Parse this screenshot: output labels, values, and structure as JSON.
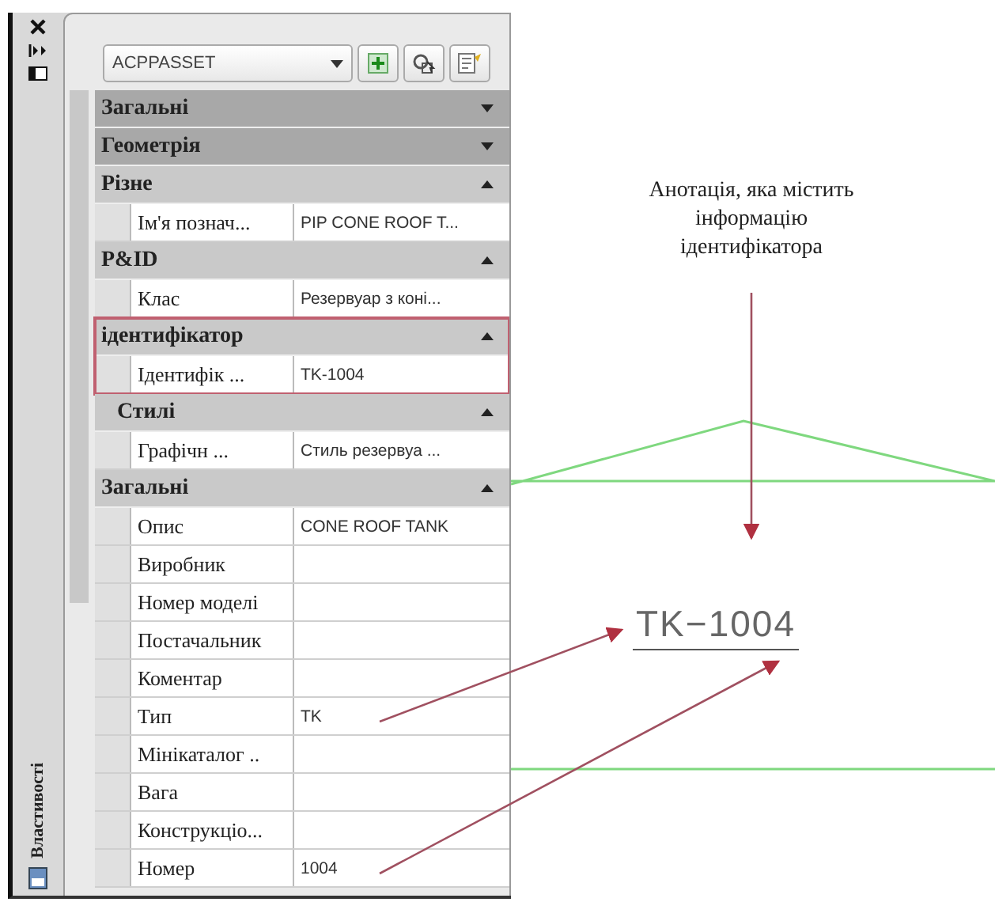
{
  "palette": {
    "title": "Властивості",
    "object_type": "ACPPASSET",
    "groups": [
      {
        "title": "Загальні",
        "kind": "category",
        "expanded": false,
        "highlighted": false
      },
      {
        "title": "Геометрія",
        "kind": "category",
        "expanded": false,
        "highlighted": false
      },
      {
        "title": "Різне",
        "kind": "category",
        "expanded": true,
        "highlighted": false,
        "properties": [
          {
            "name": "Ім'я познач...",
            "value": "PIP CONE ROOF T..."
          }
        ]
      },
      {
        "title": "P&ID",
        "kind": "category",
        "expanded": true,
        "highlighted": false,
        "properties": [
          {
            "name": "Клас",
            "value": "Резервуар з коні..."
          }
        ]
      },
      {
        "title": "ідентифікатор",
        "kind": "category",
        "expanded": true,
        "highlighted": true,
        "properties": [
          {
            "name": "Ідентифік ...",
            "value": "TK-1004"
          }
        ]
      },
      {
        "title": "Стилі",
        "kind": "subcategory",
        "expanded": true,
        "highlighted": false,
        "properties": [
          {
            "name": "Графічн ...",
            "value": "Стиль резервуа ..."
          }
        ]
      },
      {
        "title": "Загальні",
        "kind": "category",
        "expanded": true,
        "highlighted": false,
        "properties": [
          {
            "name": "Опис",
            "value": "CONE ROOF TANK"
          },
          {
            "name": "Виробник"
          },
          {
            "name": "Номер моделі"
          },
          {
            "name": "Постачальник"
          },
          {
            "name": "Коментар"
          },
          {
            "name": "Тип",
            "value": "TK"
          },
          {
            "name": "Мінікаталог .."
          },
          {
            "name": "Вага"
          },
          {
            "name": "Конструкціо..."
          },
          {
            "name": "Номер",
            "value": "1004"
          }
        ]
      }
    ]
  },
  "drawing": {
    "annotation": "Анотація, яка містить інформацію ідентифікатора",
    "tag": "TK−1004"
  }
}
